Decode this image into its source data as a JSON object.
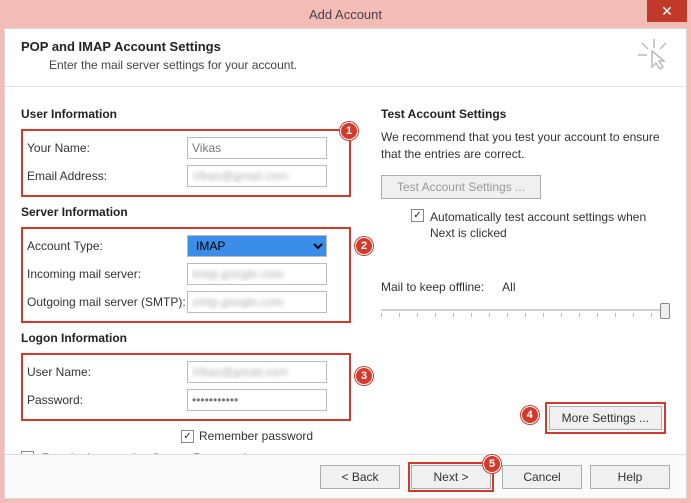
{
  "window": {
    "title": "Add Account"
  },
  "header": {
    "title": "POP and IMAP Account Settings",
    "subtitle": "Enter the mail server settings for your account."
  },
  "badges": {
    "b1": "1",
    "b2": "2",
    "b3": "3",
    "b4": "4",
    "b5": "5"
  },
  "left": {
    "user_info_title": "User Information",
    "your_name_label": "Your Name:",
    "your_name_value": "Vikas",
    "email_label": "Email Address:",
    "email_value": "Vikas@gmail.com",
    "server_info_title": "Server Information",
    "account_type_label": "Account Type:",
    "account_type_value": "IMAP",
    "incoming_label": "Incoming mail server:",
    "incoming_value": "imap.google.com",
    "outgoing_label": "Outgoing mail server (SMTP):",
    "outgoing_value": "smtp.google.com",
    "logon_title": "Logon Information",
    "username_label": "User Name:",
    "username_value": "Vikas@gmail.com",
    "password_label": "Password:",
    "password_value": "***********",
    "remember_label": "Remember password",
    "spa_label": "Require logon using Secure Password Authentication (SPA)"
  },
  "right": {
    "test_title": "Test Account Settings",
    "test_desc": "We recommend that you test your account to ensure that the entries are correct.",
    "test_btn": "Test Account Settings ...",
    "auto_test_label": "Automatically test account settings when Next is clicked",
    "mail_keep_label": "Mail to keep offline:",
    "mail_keep_value": "All",
    "more_settings": "More Settings ..."
  },
  "footer": {
    "back": "< Back",
    "next": "Next >",
    "cancel": "Cancel",
    "help": "Help"
  }
}
